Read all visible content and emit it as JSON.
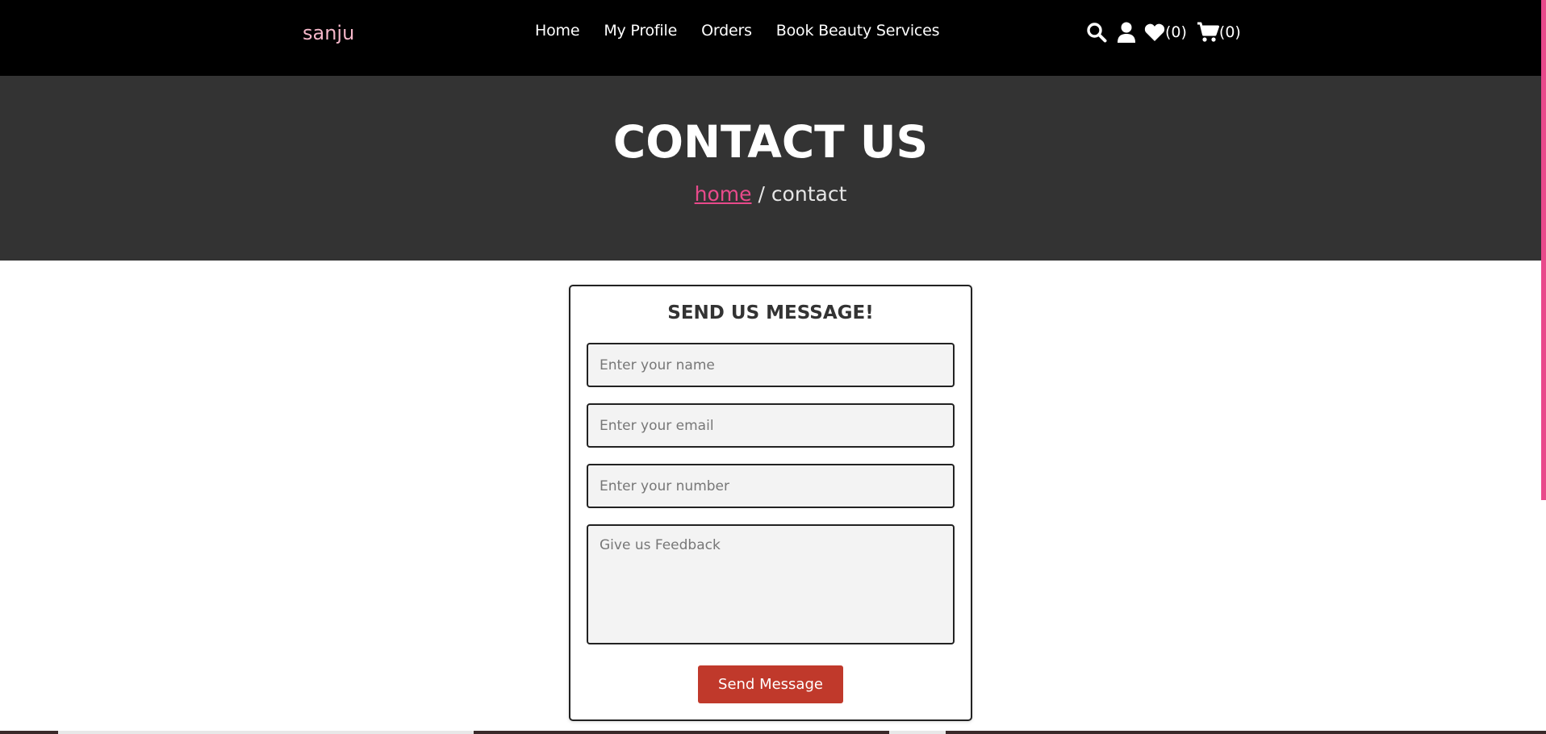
{
  "header": {
    "logo": "sanju",
    "nav": [
      "Home",
      "My Profile",
      "Orders",
      "Book Beauty Services"
    ],
    "wishlist_count": "(0)",
    "cart_count": "(0)",
    "icons": [
      "search-icon",
      "user-icon",
      "heart-icon",
      "cart-icon"
    ]
  },
  "hero": {
    "title": "CONTACT US",
    "breadcrumb_link": "home",
    "breadcrumb_current": " / contact"
  },
  "form": {
    "title": "SEND US MESSAGE!",
    "name_placeholder": "Enter your name",
    "email_placeholder": "Enter your email",
    "number_placeholder": "Enter your number",
    "feedback_placeholder": "Give us Feedback",
    "submit_label": "Send Message"
  },
  "colors": {
    "header_bg": "#000000",
    "hero_bg": "#333333",
    "accent_pink": "#e84a8b",
    "logo_pink": "#f4b6c8",
    "button_red": "#c0392b"
  }
}
